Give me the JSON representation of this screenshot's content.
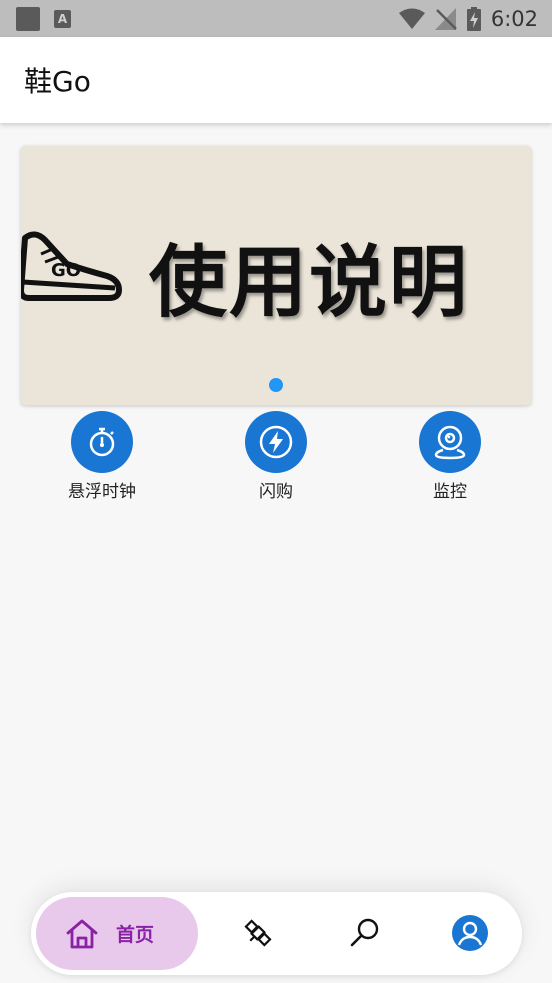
{
  "status_bar": {
    "time": "6:02"
  },
  "app_bar": {
    "title": "鞋Go"
  },
  "banner": {
    "text": "使用说明",
    "logo_text": "GO",
    "accent_color": "#2196f3"
  },
  "actions": [
    {
      "label": "悬浮时钟",
      "icon": "stopwatch-icon"
    },
    {
      "label": "闪购",
      "icon": "lightning-icon"
    },
    {
      "label": "监控",
      "icon": "webcam-icon"
    }
  ],
  "bottom_nav": {
    "home_label": "首页",
    "items": [
      "home-icon",
      "satellite-icon",
      "search-icon",
      "account-icon"
    ],
    "active_color": "#8a22a6",
    "active_bg": "#e8c9ec"
  },
  "colors": {
    "primary": "#1976d2",
    "dot": "#2196f3"
  }
}
